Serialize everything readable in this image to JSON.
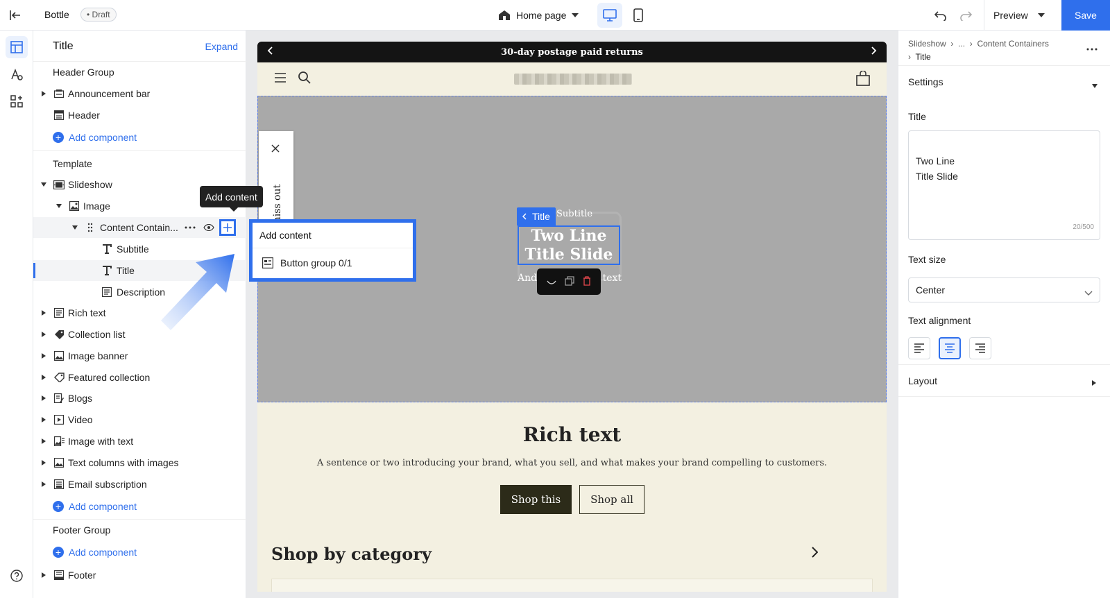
{
  "topbar": {
    "store_name": "Bottle",
    "status_badge": "• Draft",
    "page_name": "Home page",
    "preview_label": "Preview",
    "save_label": "Save"
  },
  "tree": {
    "title": "Title",
    "expand_label": "Expand",
    "header_group": "Header Group",
    "announcement_bar": "Announcement bar",
    "header": "Header",
    "add_component": "Add component",
    "template": "Template",
    "slideshow": "Slideshow",
    "image": "Image",
    "content_containers": "Content Contain...",
    "subtitle": "Subtitle",
    "description": "Description",
    "sections": [
      "Rich text",
      "Collection list",
      "Image banner",
      "Featured collection",
      "Blogs",
      "Video",
      "Image with text",
      "Text columns with images",
      "Email subscription"
    ],
    "footer_group": "Footer Group",
    "footer": "Footer"
  },
  "tooltip": {
    "label": "Add content"
  },
  "add_menu": {
    "header": "Add content",
    "item": "Button group 0/1"
  },
  "site": {
    "promo": "30-day postage paid returns",
    "popup_text": "Don't miss out",
    "slide_subtitle": "Subtitle",
    "slide_title_line1": "Two Line",
    "slide_title_line2": "Title Slide",
    "slide_desc_left": "And",
    "slide_desc_right": "text",
    "title_tag": "Title",
    "rich_title": "Rich text",
    "rich_text": "A sentence or two introducing your brand, what you sell, and what makes your brand compelling to customers.",
    "btn_primary": "Shop this",
    "btn_secondary": "Shop all",
    "category_title": "Shop by category"
  },
  "settings": {
    "crumb_1": "Slideshow",
    "crumb_2": "...",
    "crumb_3": "Content Containers",
    "crumb_4": "Title",
    "settings_header": "Settings",
    "title_label": "Title",
    "title_value": "Two Line\nTitle Slide",
    "title_count": "20/500",
    "text_size_label": "Text size",
    "text_size_value": "Center",
    "alignment_label": "Text alignment",
    "layout_label": "Layout"
  },
  "colors": {
    "accent": "#2f6fec",
    "site_bg": "#f3f0e1",
    "dark_button": "#2c2b19"
  }
}
